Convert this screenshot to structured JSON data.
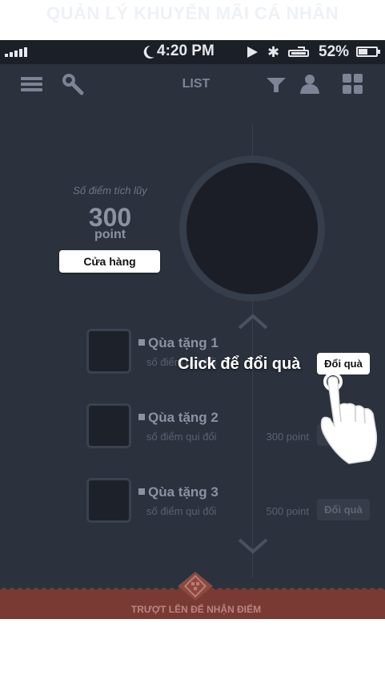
{
  "page_title": "QUẢN LÝ KHUYẾN MÃI CÁ NHÂN",
  "status_bar": {
    "time": "4:20 PM",
    "battery_percent": "52%",
    "battery_level": 0.52,
    "bluetooth_glyph": "✱"
  },
  "nav": {
    "title": "LIST",
    "left_icons": [
      "menu-icon",
      "search-icon"
    ],
    "right_icons": [
      "filter-icon",
      "user-icon",
      "grid-icon"
    ]
  },
  "points": {
    "label": "Số điểm tích lũy",
    "value": "300",
    "unit": "point",
    "store_button": "Cửa hàng"
  },
  "gifts": [
    {
      "name": "Qùa tặng 1",
      "sub": "số điểm qui đổi",
      "point": "",
      "button": "Đổi quà"
    },
    {
      "name": "Qùa tặng 2",
      "sub": "số điểm qui đổi",
      "point": "300 point",
      "button": "Đổi quà"
    },
    {
      "name": "Qùa tặng 3",
      "sub": "số điểm qui đổi",
      "point": "500 point",
      "button": "Đổi quà"
    }
  ],
  "hint": {
    "text": "Click để đổi quà",
    "active_button": "Đổi quà"
  },
  "footer": {
    "text": "TRƯỢT LÊN ĐỂ NHẬN ĐIỂM"
  },
  "colors": {
    "background": "#2b313d",
    "status_bar": "#1b1f27",
    "footer": "#7a3a34",
    "accent_white": "#ffffff"
  }
}
